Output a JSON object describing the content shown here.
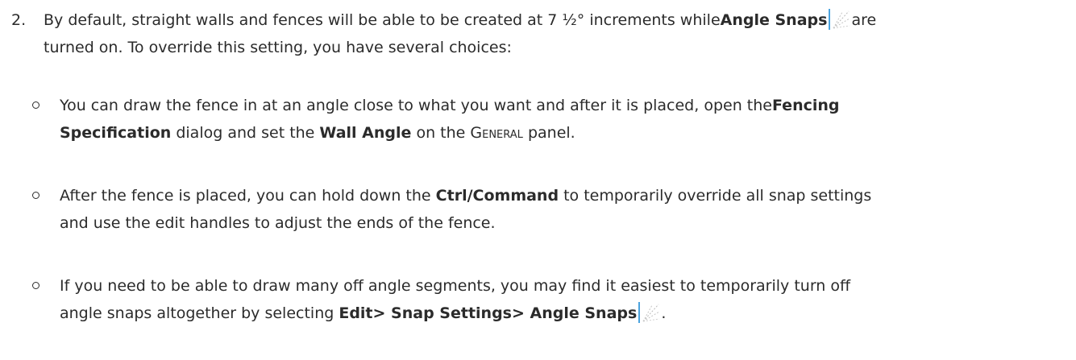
{
  "step": {
    "number": "2.",
    "line1_before": "By default, straight walls and fences will be able to be created at 7 ½° increments while",
    "line1_bold": "Angle Snaps",
    "line1_after": "are",
    "line2": "turned on. To override this setting, you have several choices:"
  },
  "bullets": [
    {
      "line1_before": "You can draw the fence in at an angle close to what you want and after it is placed, open the",
      "line1_bold": "Fencing",
      "line2_bold1": "Specification",
      "line2_mid": "dialog and set the",
      "line2_bold2": "Wall Angle",
      "line2_before_sc": "on the",
      "line2_sc": "General",
      "line2_after": "panel."
    },
    {
      "line1_before": "After the fence is placed, you can hold down the",
      "line1_bold": "Ctrl/Command",
      "line1_after": "to temporarily override all snap settings",
      "line2": "and use the edit handles to adjust the ends of the fence."
    },
    {
      "line1": "If you need to be able to draw many off angle segments, you may find it easiest to temporarily turn off",
      "line2_before": "angle snaps altogether by selecting",
      "line2_bold": "Edit> Snap Settings> Angle Snaps",
      "line2_after": "."
    }
  ],
  "icons": {
    "angle_snaps": "angle-snaps-icon"
  },
  "colors": {
    "text": "#2b2b2b",
    "icon_accent": "#4aa3df"
  }
}
